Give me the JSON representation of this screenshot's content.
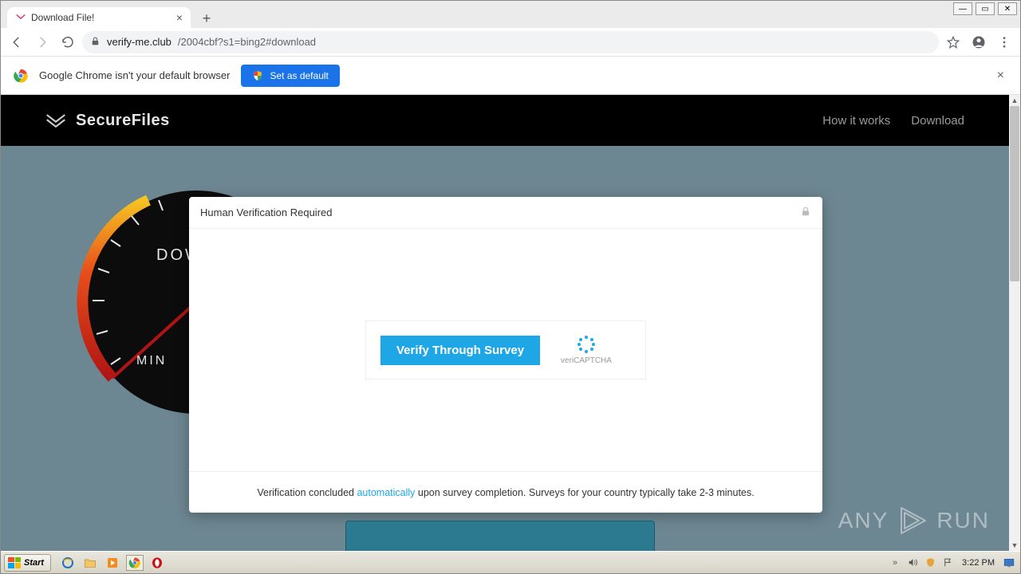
{
  "tab": {
    "title": "Download File!"
  },
  "url": {
    "host": "verify-me.club",
    "path": "/2004cbf?s1=bing2#download"
  },
  "infobar": {
    "text": "Google Chrome isn't your default browser",
    "button": "Set as default"
  },
  "site": {
    "brand": "SecureFiles",
    "nav": {
      "how": "How it works",
      "download": "Download"
    },
    "gauge": {
      "dow": "DOW",
      "min": "MIN"
    }
  },
  "modal": {
    "title": "Human Verification Required",
    "verify_btn": "Verify Through Survey",
    "captcha_brand": "veriCAPTCHA",
    "footer_pre": "Verification concluded ",
    "footer_auto": "automatically",
    "footer_post": " upon survey completion. Surveys for your country typically take 2-3 minutes."
  },
  "watermark": {
    "left": "ANY",
    "right": "RUN"
  },
  "taskbar": {
    "start": "Start",
    "clock": "3:22 PM"
  }
}
